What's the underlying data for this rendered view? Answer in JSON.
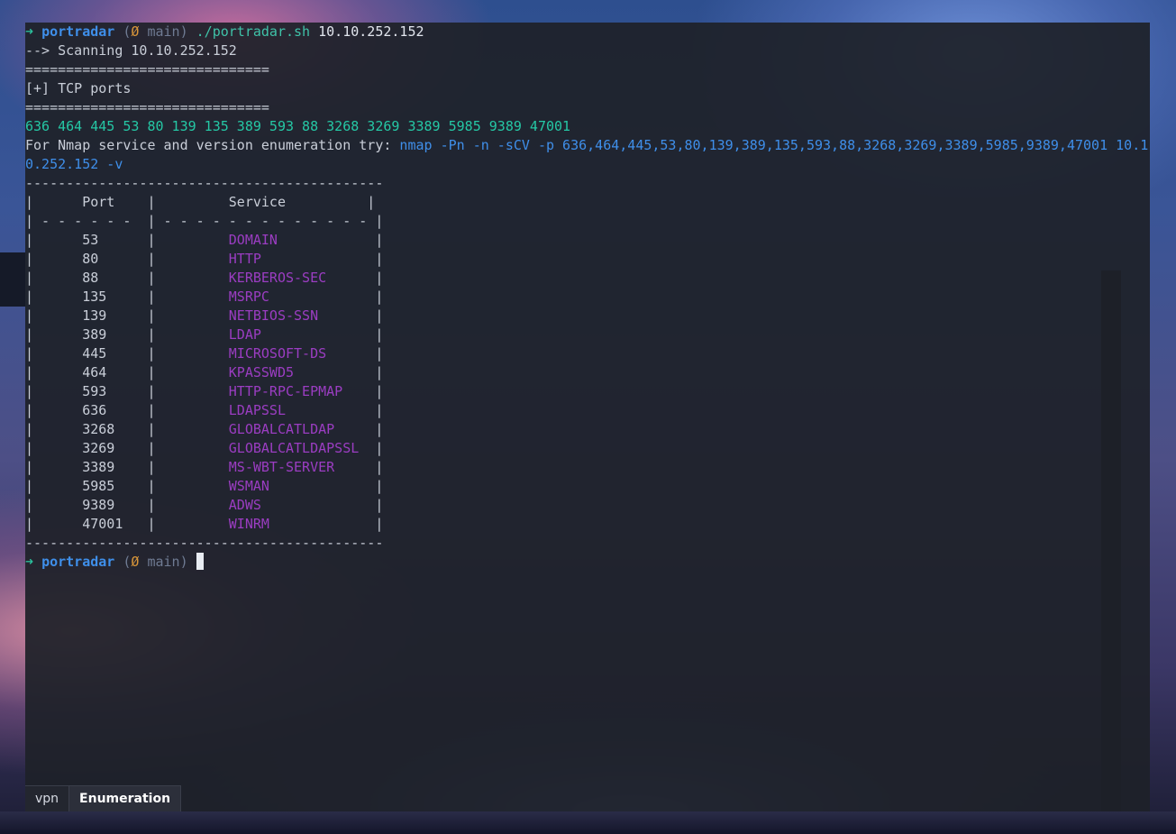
{
  "prompt": {
    "arrow": "➜",
    "dir": "portradar",
    "git_open": "(",
    "git_icon": "Ø",
    "git_branch": "main",
    "git_close": ")"
  },
  "lines": {
    "command": "./portradar.sh",
    "command_arg": "10.10.252.152",
    "scanning": "--> Scanning 10.10.252.152",
    "separator": "==============================",
    "tcp_header": "[+] TCP ports",
    "ports_list": "636 464 445 53 80 139 135 389 593 88 3268 3269 3389 5985 9389 47001",
    "nmap_hint_prefix": "For Nmap service and version enumeration try: ",
    "nmap_cmd_line1": "nmap -Pn -n -sCV -p 636,464,445,53,80,139,389,135,593,88,3268,3269,3389,5985,9389,47001 10.1",
    "nmap_cmd_line2": "0.252.152 -v"
  },
  "table": {
    "border": "--------------------------------------------",
    "header_left": "|      Port    |          Service           |",
    "header_port": "Port",
    "header_service": "Service",
    "divider": "| - - - - - -  | - - - - - - - - - - - - - |",
    "rows": [
      {
        "port": "53",
        "service": "DOMAIN"
      },
      {
        "port": "80",
        "service": "HTTP"
      },
      {
        "port": "88",
        "service": "KERBEROS-SEC"
      },
      {
        "port": "135",
        "service": "MSRPC"
      },
      {
        "port": "139",
        "service": "NETBIOS-SSN"
      },
      {
        "port": "389",
        "service": "LDAP"
      },
      {
        "port": "445",
        "service": "MICROSOFT-DS"
      },
      {
        "port": "464",
        "service": "KPASSWD5"
      },
      {
        "port": "593",
        "service": "HTTP-RPC-EPMAP"
      },
      {
        "port": "636",
        "service": "LDAPSSL"
      },
      {
        "port": "3268",
        "service": "GLOBALCATLDAP"
      },
      {
        "port": "3269",
        "service": "GLOBALCATLDAPSSL"
      },
      {
        "port": "3389",
        "service": "MS-WBT-SERVER"
      },
      {
        "port": "5985",
        "service": "WSMAN"
      },
      {
        "port": "9389",
        "service": "ADWS"
      },
      {
        "port": "47001",
        "service": "WINRM"
      }
    ]
  },
  "tabs": [
    {
      "label": "vpn",
      "active": false
    },
    {
      "label": "Enumeration",
      "active": true
    }
  ],
  "colors": {
    "terminal_bg": "#1e2129",
    "prompt_green": "#2bbd9b",
    "link_blue": "#3f8fea",
    "service_purple": "#9b3dc2"
  }
}
